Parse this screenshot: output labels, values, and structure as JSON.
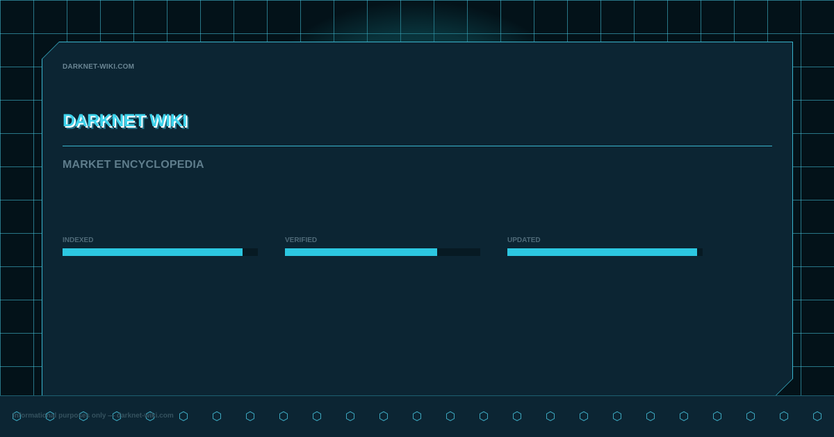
{
  "header": {
    "domain": "DARKNET-WIKI.COM",
    "title": "DARKNET WIKI",
    "subtitle": "MARKET ENCYCLOPEDIA"
  },
  "stats": [
    {
      "label": "INDEXED",
      "level": 0.92
    },
    {
      "label": "VERIFIED",
      "level": 0.78
    },
    {
      "label": "UPDATED",
      "level": 0.97
    }
  ],
  "footer": {
    "text": "Informational purposes only — darknet-wiki.com"
  },
  "colors": {
    "accent": "#2cc7e1",
    "background": "#031219",
    "card": "#0c2533",
    "grid": "#48c8e2"
  },
  "icons": {
    "footer_pattern": "hexagon-icon"
  }
}
